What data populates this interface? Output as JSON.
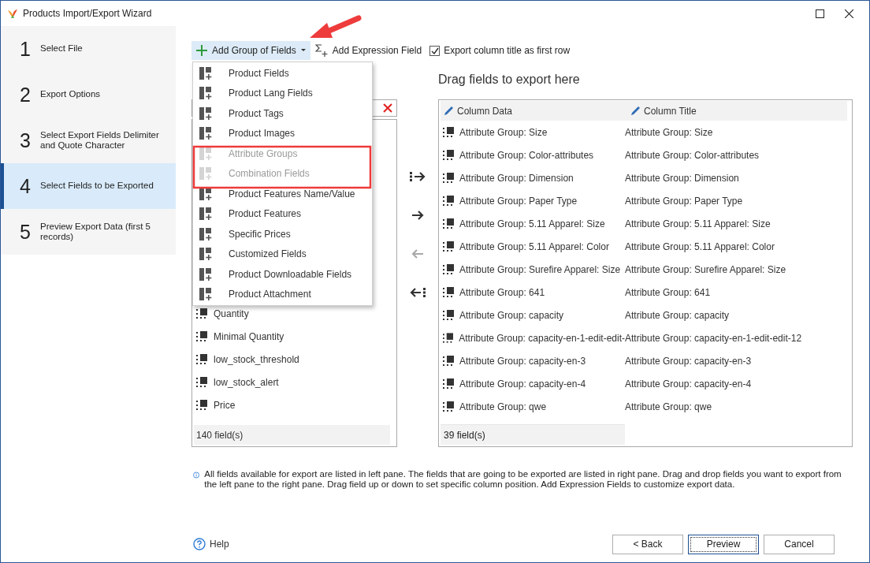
{
  "window": {
    "title": "Products Import/Export Wizard"
  },
  "steps": [
    {
      "number": "1",
      "label": "Select File",
      "selected": false
    },
    {
      "number": "2",
      "label": "Export Options",
      "selected": false
    },
    {
      "number": "3",
      "label": "Select Export Fields Delimiter and Quote Character",
      "selected": false
    },
    {
      "number": "4",
      "label": "Select Fields to be Exported",
      "selected": true
    },
    {
      "number": "5",
      "label": "Preview Export Data (first 5 records)",
      "selected": false
    }
  ],
  "toolbar": {
    "add_group": {
      "label": "Add Group of Fields",
      "expanded": true
    },
    "add_expression": {
      "label": "Add Expression Field"
    },
    "export_title": {
      "label": "Export column title as first row",
      "checked": true
    }
  },
  "group_menu": [
    {
      "label": "Product Fields",
      "disabled": false
    },
    {
      "label": "Product Lang Fields",
      "disabled": false
    },
    {
      "label": "Product Tags",
      "disabled": false
    },
    {
      "label": "Product Images",
      "disabled": false
    },
    {
      "label": "Attribute Groups",
      "disabled": true
    },
    {
      "label": "Combination Fields",
      "disabled": true
    },
    {
      "label": "Product Features Name/Value",
      "disabled": false
    },
    {
      "label": "Product Features",
      "disabled": false
    },
    {
      "label": "Specific Prices",
      "disabled": false
    },
    {
      "label": "Customized Fields",
      "disabled": false
    },
    {
      "label": "Product Downloadable Fields",
      "disabled": false
    },
    {
      "label": "Product Attachment",
      "disabled": false
    }
  ],
  "left_pane": {
    "fields": [
      "Quantity",
      "Minimal Quantity",
      "low_stock_threshold",
      "low_stock_alert",
      "Price"
    ],
    "count": "140 field(s)"
  },
  "move_buttons": [
    {
      "kind": "all-right",
      "disabled": false
    },
    {
      "kind": "right",
      "disabled": false
    },
    {
      "kind": "left",
      "disabled": true
    },
    {
      "kind": "all-left",
      "disabled": false
    }
  ],
  "right_pane": {
    "heading": "Drag fields to export here",
    "columns": [
      "Column Data",
      "Column Title"
    ],
    "rows": [
      {
        "data": "Attribute Group: Size",
        "title": "Attribute Group: Size"
      },
      {
        "data": "Attribute Group: Color-attributes",
        "title": "Attribute Group: Color-attributes"
      },
      {
        "data": "Attribute Group: Dimension",
        "title": "Attribute Group: Dimension"
      },
      {
        "data": "Attribute Group: Paper Type",
        "title": "Attribute Group: Paper Type"
      },
      {
        "data": "Attribute Group: 5.11 Apparel: Size",
        "title": "Attribute Group: 5.11 Apparel: Size"
      },
      {
        "data": "Attribute Group: 5.11 Apparel: Color",
        "title": "Attribute Group: 5.11 Apparel: Color"
      },
      {
        "data": "Attribute Group: Surefire Apparel: Size",
        "title": "Attribute Group: Surefire Apparel: Size"
      },
      {
        "data": "Attribute Group: 641",
        "title": "Attribute Group: 641"
      },
      {
        "data": "Attribute Group: capacity",
        "title": "Attribute Group: capacity"
      },
      {
        "data": "Attribute Group: capacity-en-1-edit-edit-",
        "title": "Attribute Group: capacity-en-1-edit-edit-12"
      },
      {
        "data": "Attribute Group: capacity-en-3",
        "title": "Attribute Group: capacity-en-3"
      },
      {
        "data": "Attribute Group: capacity-en-4",
        "title": "Attribute Group: capacity-en-4"
      },
      {
        "data": "Attribute Group: qwe",
        "title": "Attribute Group: qwe"
      }
    ],
    "count": "39 field(s)"
  },
  "info": "All fields available for export are listed in left pane. The fields that are going to be exported are listed in right pane. Drag and drop fields you want to export from the left pane to the right pane. Drag field up or down to set specific column position. Add Expression Fields to customize export data.",
  "help": "Help",
  "buttons": [
    {
      "label": "< Back",
      "default": false
    },
    {
      "label": "Preview",
      "default": true
    },
    {
      "label": "Cancel",
      "default": false
    }
  ]
}
